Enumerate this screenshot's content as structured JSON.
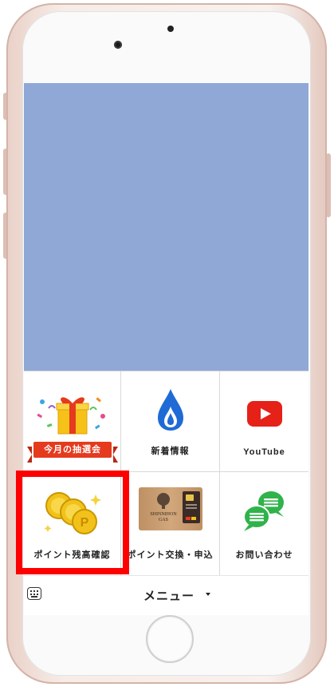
{
  "banner": {
    "color": "#8fa8d6"
  },
  "tiles": [
    {
      "name": "lottery",
      "label": "",
      "ribbon": "今月の抽選会",
      "icon": "gift-icon"
    },
    {
      "name": "news",
      "label": "新着情報",
      "icon": "water-drop-icon"
    },
    {
      "name": "youtube",
      "label": "YouTube",
      "icon": "youtube-play-icon"
    },
    {
      "name": "points",
      "label": "ポイント残高確認",
      "icon": "coins-icon"
    },
    {
      "name": "exchange",
      "label": "ポイント交換・申込",
      "icon": "point-card-icon"
    },
    {
      "name": "contact",
      "label": "お問い合わせ",
      "icon": "chat-bubbles-icon"
    }
  ],
  "card": {
    "brand_line1": "SHINNIHON",
    "brand_line2": "GAS"
  },
  "menu": {
    "label": "メニュー",
    "keyboard_icon": "keyboard-icon",
    "caret_icon": "caret-down-icon"
  },
  "colors": {
    "highlight": "#ff0000",
    "ribbon": "#e53a1e",
    "youtube": "#e62117",
    "drop": "#1e6bd6",
    "chat": "#2fb34a"
  }
}
